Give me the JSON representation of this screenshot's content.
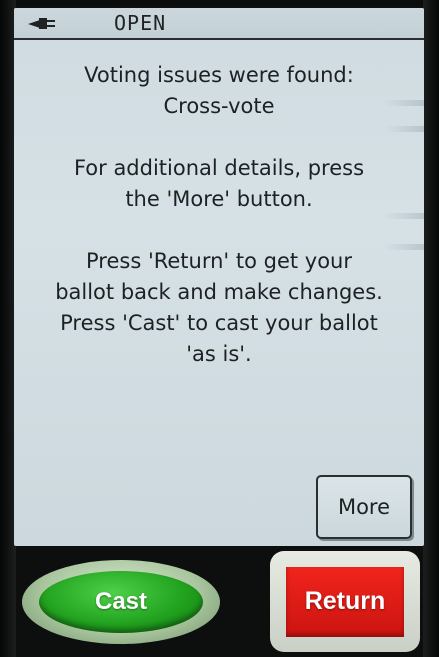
{
  "status_bar": {
    "power_icon": "plug-icon",
    "status_text": "OPEN"
  },
  "message": {
    "line1": "Voting issues were found:",
    "line2": "Cross-vote",
    "line3": "For additional details, press",
    "line4": "the 'More' button.",
    "line5": "Press 'Return' to get your",
    "line6": "ballot back and make changes.",
    "line7": "Press 'Cast' to cast your ballot",
    "line8": "'as is'."
  },
  "buttons": {
    "more_label": "More",
    "cast_label": "Cast",
    "return_label": "Return"
  },
  "colors": {
    "cast_green": "#22a31f",
    "return_red": "#e01a15",
    "screen_bg": "#d3dee3"
  }
}
